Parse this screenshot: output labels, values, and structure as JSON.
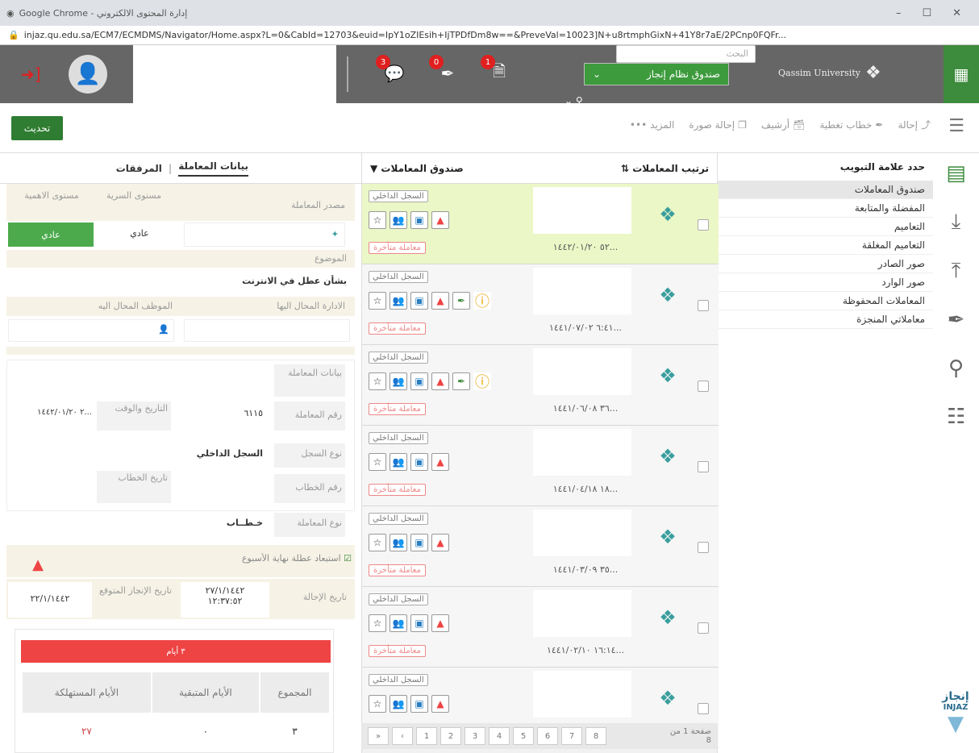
{
  "browser": {
    "title": "Google Chrome - إدارة المحتوى الالكتروني",
    "url": "injaz.qu.edu.sa/ECM7/ECMDMS/Navigator/Home.aspx?L=0&CabId=12703&euid=IpY1oZIEsih+IjTPDfDm8w==&PreveVal=10023]N+u8rtmphGixN+41Y8r7aE/2PCnp0FQFr...",
    "win_controls": [
      "–",
      "☐",
      "✕"
    ]
  },
  "header": {
    "box_select_label": "صندوق نظام إنجاز",
    "search_placeholder": "البحث",
    "notifications": [
      {
        "icon": "chat-icon",
        "count": "3"
      },
      {
        "icon": "feather-icon",
        "count": "0"
      },
      {
        "icon": "document-icon",
        "count": "1"
      }
    ],
    "logo_text": "Qassim University"
  },
  "toolbar": {
    "refresh": "تحديث",
    "actions": [
      {
        "label": "إحالة",
        "icon": "share-icon"
      },
      {
        "label": "خطاب تغطية",
        "icon": "feather-icon"
      },
      {
        "label": "أرشيف",
        "icon": "archive-icon"
      },
      {
        "label": "إحالة صورة",
        "icon": "copy-icon"
      },
      {
        "label": "المزيد",
        "icon": "more-icon"
      }
    ]
  },
  "tabs_panel": {
    "heading": "حدد علامة التبويب",
    "items": [
      "صندوق المعاملات",
      "المفضلة والمتابعة",
      "التعاميم",
      "التعاميم المغلقة",
      "صور الصادر",
      "صور الوارد",
      "المعاملات المحفوظة",
      "معاملاتي المنجزة"
    ]
  },
  "transactions": {
    "sort_label": "ترتيب المعاملات",
    "box_label": "صندوق المعاملات",
    "register_label": "السجل الداخلي",
    "late_label": "معاملة متأخرة",
    "rows": [
      {
        "date": "...٥٢ ١٤٤٢/٠١/٢٠"
      },
      {
        "date": "...٦:٤١ ١٤٤١/٠٧/٠٢"
      },
      {
        "date": "...٣٦ ١٤٤١/٠٦/٠٨"
      },
      {
        "date": "...١٨ ١٤٤١/٠٤/١٨"
      },
      {
        "date": "...٣٥ ١٤٤١/٠٣/٠٩"
      },
      {
        "date": "...١٦:١٤ ١٤٤١/٠٢/١٠"
      },
      {
        "date": ""
      }
    ],
    "pager_info": "صفحة 1 من 8",
    "pages": [
      "»",
      "‹",
      "1",
      "2",
      "3",
      "4",
      "5",
      "6",
      "7",
      "8"
    ]
  },
  "details": {
    "tab_data": "بيانات المعاملة",
    "tab_attachments": "المرفقات",
    "source_label": "مصدر المعاملة",
    "secrecy_label": "مستوى السرية",
    "importance_label": "مستوى الاهمية",
    "secrecy_value": "عادي",
    "importance_value": "عادي",
    "subject_label": "الموضوع",
    "subject_value": "بشأن عطل في الانترنت",
    "dept_label": "الادارة المحال اليها",
    "employee_label": "الموظف المحال اليه",
    "data_label": "بيانات المعاملة",
    "number_label": "رقم المعاملة",
    "number_value": "٦١١٥",
    "datetime_label": "التاريخ والوقت",
    "datetime_value": "...٢ ١٤٤٢/٠١/٢٠",
    "register_type_label": "نوع السجل",
    "register_type_value": "السجل الداخلي",
    "letter_number_label": "رقم الخطاب",
    "letter_date_label": "تاريخ الخطاب",
    "type_label": "نوع المعاملة",
    "type_value": "خـطــاب",
    "exclude_weekend": "استبعاد عطلة نهاية الأسبوع",
    "referral_date_label": "تاريخ الإحالة",
    "referral_date_value": "٢٧/١/١٤٤٢",
    "referral_time_value": "١٢:٣٧:٥٢",
    "expected_label": "تاريخ الإنجاز المتوقع",
    "expected_value": "٢٢/١/١٤٤٢",
    "days_bar": "٣ أيام",
    "col_total": "المجموع",
    "col_remaining": "الأيام المتبقية",
    "col_consumed": "الأيام المستهلكة",
    "val_total": "٣",
    "val_remaining": "٠",
    "val_consumed": "٢٧"
  },
  "brand": {
    "injaz": "إنجاز",
    "injaz_en": "INJAZ"
  }
}
